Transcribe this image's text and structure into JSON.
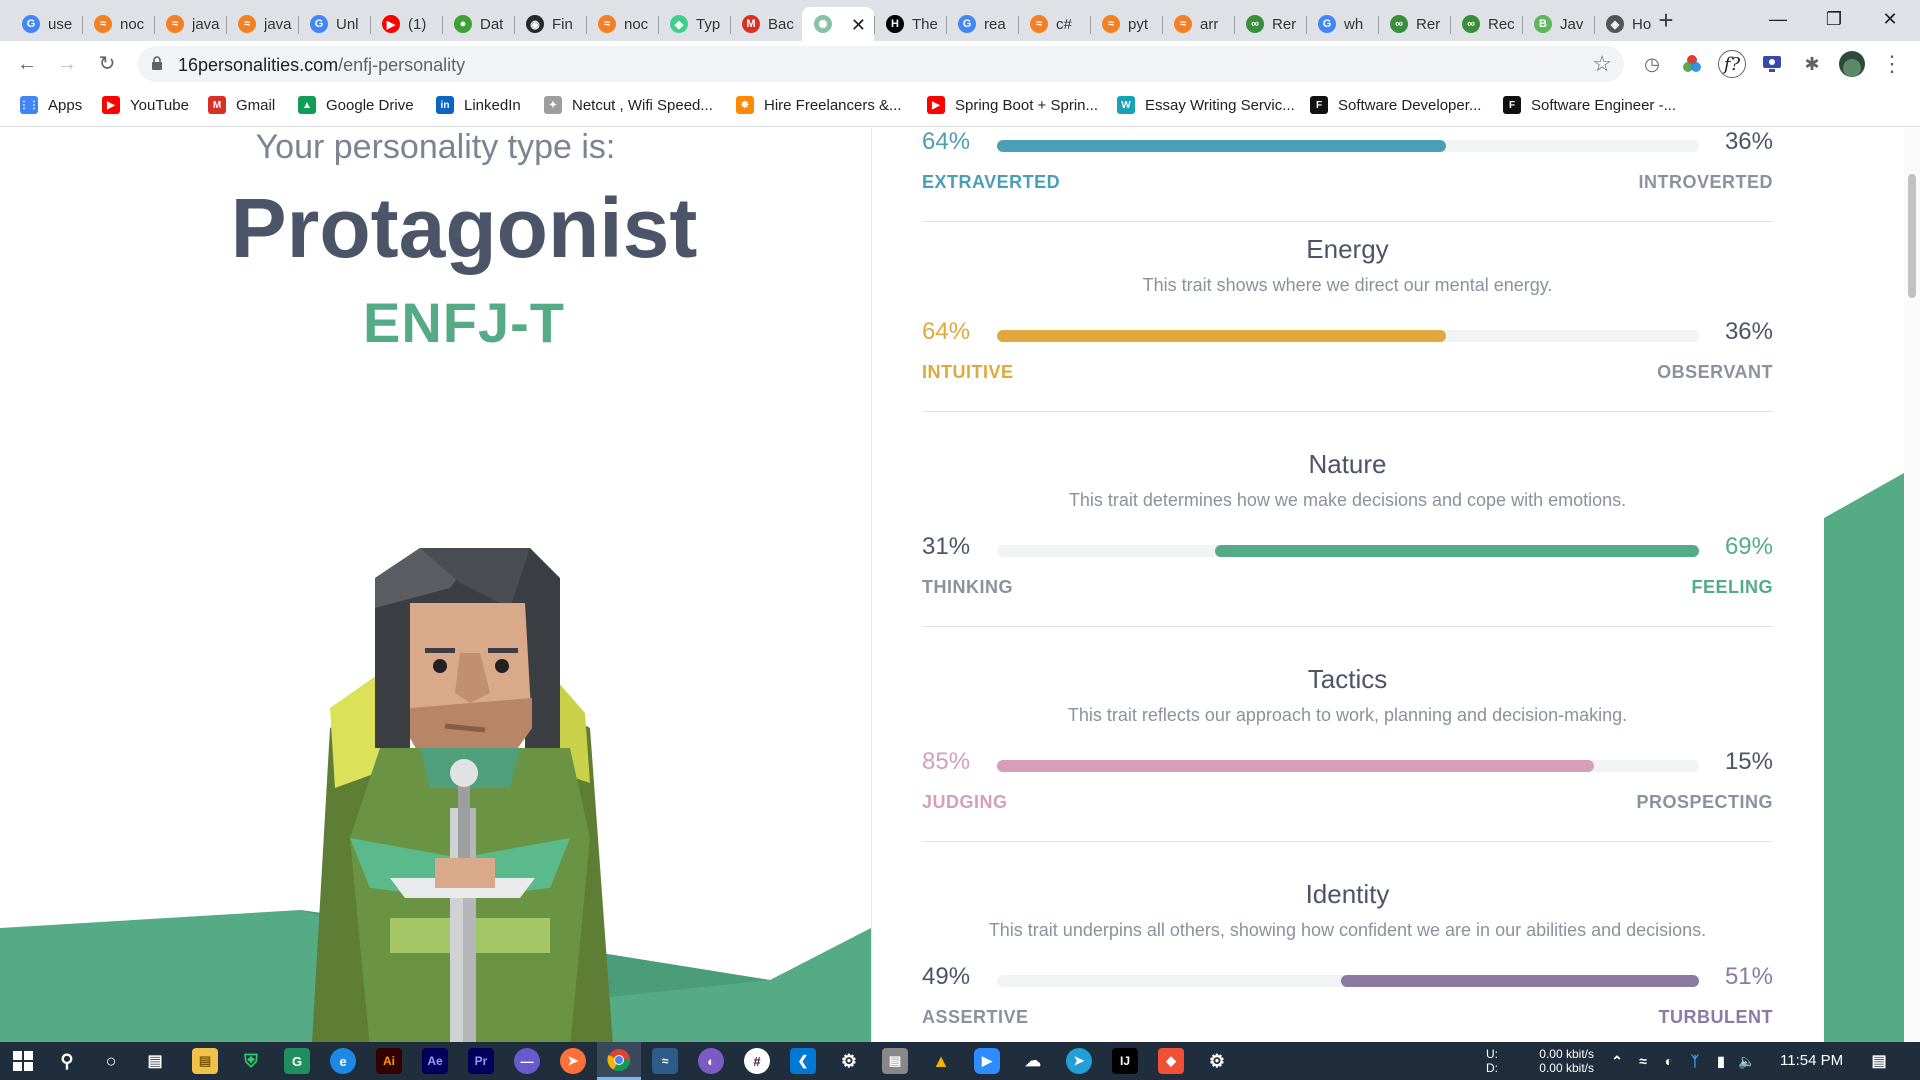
{
  "browser": {
    "tabs": [
      {
        "title": "use",
        "fav": "G",
        "color": "#4285f4"
      },
      {
        "title": "noc",
        "fav": "≈",
        "color": "#f48024"
      },
      {
        "title": "java",
        "fav": "≈",
        "color": "#f48024"
      },
      {
        "title": "java",
        "fav": "≈",
        "color": "#f48024"
      },
      {
        "title": "Unl",
        "fav": "G",
        "color": "#4285f4"
      },
      {
        "title": "(1)",
        "fav": "▶",
        "color": "#ff0000"
      },
      {
        "title": "Dat",
        "fav": "●",
        "color": "#3fa037"
      },
      {
        "title": "Fin",
        "fav": "◉",
        "color": "#24292e"
      },
      {
        "title": "noc",
        "fav": "≈",
        "color": "#f48024"
      },
      {
        "title": "Typ",
        "fav": "◆",
        "color": "#3ecf8e"
      },
      {
        "title": "Bac",
        "fav": "M",
        "color": "#d93025"
      },
      {
        "title": "",
        "fav": "✺",
        "color": "#88c0a8",
        "active": true
      },
      {
        "title": "The",
        "fav": "H",
        "color": "#000000"
      },
      {
        "title": "rea",
        "fav": "G",
        "color": "#4285f4"
      },
      {
        "title": "c#",
        "fav": "≈",
        "color": "#f48024"
      },
      {
        "title": "pyt",
        "fav": "≈",
        "color": "#f48024"
      },
      {
        "title": "arr",
        "fav": "≈",
        "color": "#f48024"
      },
      {
        "title": "Rer",
        "fav": "∞",
        "color": "#3a8d3a"
      },
      {
        "title": "wh",
        "fav": "G",
        "color": "#4285f4"
      },
      {
        "title": "Rer",
        "fav": "∞",
        "color": "#3a8d3a"
      },
      {
        "title": "Rec",
        "fav": "∞",
        "color": "#3a8d3a"
      },
      {
        "title": "Jav",
        "fav": "B",
        "color": "#5cb85c"
      },
      {
        "title": "Ho",
        "fav": "◈",
        "color": "#555555"
      }
    ],
    "url_domain": "16personalities.com",
    "url_path": "/enfj-personality",
    "bookmarks": [
      {
        "label": "Apps",
        "icon": "⋮⋮",
        "color": "#4285f4"
      },
      {
        "label": "YouTube",
        "icon": "▶",
        "color": "#ff0000"
      },
      {
        "label": "Gmail",
        "icon": "M",
        "color": "#d93025"
      },
      {
        "label": "Google Drive",
        "icon": "▲",
        "color": "#0f9d58"
      },
      {
        "label": "LinkedIn",
        "icon": "in",
        "color": "#0a66c2"
      },
      {
        "label": "Netcut , Wifi Speed...",
        "icon": "✦",
        "color": "#9e9e9e"
      },
      {
        "label": "Hire Freelancers &...",
        "icon": "✸",
        "color": "#ff8a00"
      },
      {
        "label": "Spring Boot + Sprin...",
        "icon": "▶",
        "color": "#ff0000"
      },
      {
        "label": "Essay Writing Servic...",
        "icon": "W",
        "color": "#17a2b8"
      },
      {
        "label": "Software Developer...",
        "icon": "F",
        "color": "#111111"
      },
      {
        "label": "Software Engineer -...",
        "icon": "F",
        "color": "#111111"
      }
    ]
  },
  "profile": {
    "intro": "Your personality type is:",
    "name": "Protagonist",
    "code": "ENFJ-T"
  },
  "traits_top": {
    "left_pct": "64%",
    "right_pct": "36%",
    "left_label": "EXTRAVERTED",
    "right_label": "INTROVERTED",
    "fill": 0.64,
    "color": "#4a9fb5"
  },
  "traits": [
    {
      "name": "Energy",
      "desc": "This trait shows where we direct our mental energy.",
      "left_pct": "64%",
      "right_pct": "36%",
      "left_label": "INTUITIVE",
      "right_label": "OBSERVANT",
      "fill": 0.64,
      "side": "left",
      "color": "#e0a83d"
    },
    {
      "name": "Nature",
      "desc": "This trait determines how we make decisions and cope with emotions.",
      "left_pct": "31%",
      "right_pct": "69%",
      "left_label": "THINKING",
      "right_label": "FEELING",
      "fill": 0.69,
      "side": "right",
      "color": "#55ab86"
    },
    {
      "name": "Tactics",
      "desc": "This trait reflects our approach to work, planning and decision-making.",
      "left_pct": "85%",
      "right_pct": "15%",
      "left_label": "JUDGING",
      "right_label": "PROSPECTING",
      "fill": 0.85,
      "side": "left",
      "color": "#d59fb9"
    },
    {
      "name": "Identity",
      "desc": "This trait underpins all others, showing how confident we are in our abilities and decisions.",
      "left_pct": "49%",
      "right_pct": "51%",
      "left_label": "ASSERTIVE",
      "right_label": "TURBULENT",
      "fill": 0.51,
      "side": "right",
      "color": "#8c7aa3"
    }
  ],
  "taskbar": {
    "net_up_label": "U:",
    "net_down_label": "D:",
    "net_up": "0.00 kbit/s",
    "net_down": "0.00 kbit/s",
    "time": "11:54 PM"
  }
}
